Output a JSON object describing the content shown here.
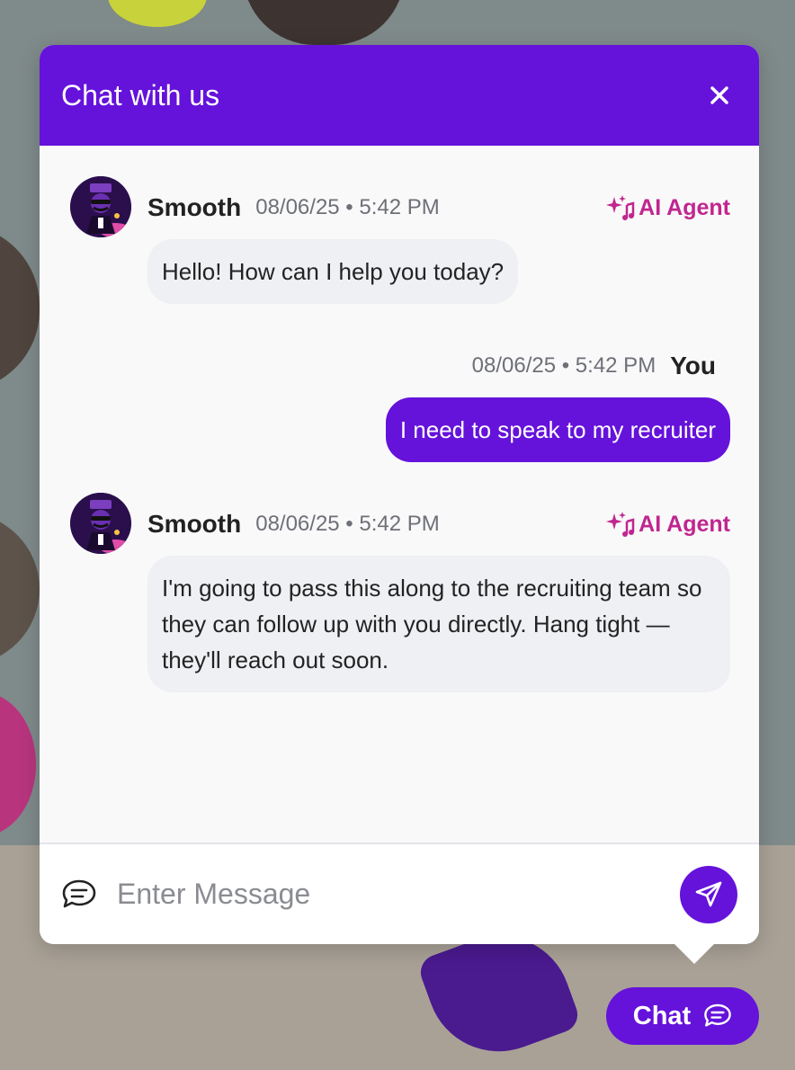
{
  "header": {
    "title": "Chat with us"
  },
  "messages": [
    {
      "sender": "Smooth",
      "time": "08/06/25 • 5:42 PM",
      "badge": "AI Agent",
      "text": "Hello! How can I help you today?"
    },
    {
      "sender": "You",
      "time": "08/06/25 • 5:42 PM",
      "text": "I need to speak to my recruiter"
    },
    {
      "sender": "Smooth",
      "time": "08/06/25 • 5:42 PM",
      "badge": "AI Agent",
      "text": "I'm going to pass this along to the recruiting team so they can follow up with you directly. Hang tight — they'll reach out soon."
    }
  ],
  "composer": {
    "placeholder": "Enter Message"
  },
  "launcher": {
    "label": "Chat"
  },
  "colors": {
    "brand": "#6512db",
    "ai_badge": "#c0268f"
  }
}
